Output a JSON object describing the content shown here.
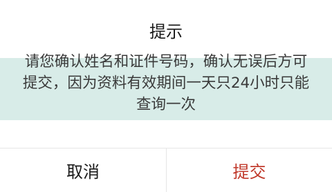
{
  "dialog": {
    "title": "提示",
    "message_lines": [
      "请您确认姓名和证件号码，确认无误后方可",
      "提交，因为资料有效期间一天只24小时只能",
      "查询一次"
    ],
    "cancel_label": "取消",
    "submit_label": "提交"
  },
  "background": {
    "watermark_lines": [
      "",
      ""
    ]
  },
  "colors": {
    "submit_text": "#c0392b",
    "band": "#d8ece8"
  }
}
